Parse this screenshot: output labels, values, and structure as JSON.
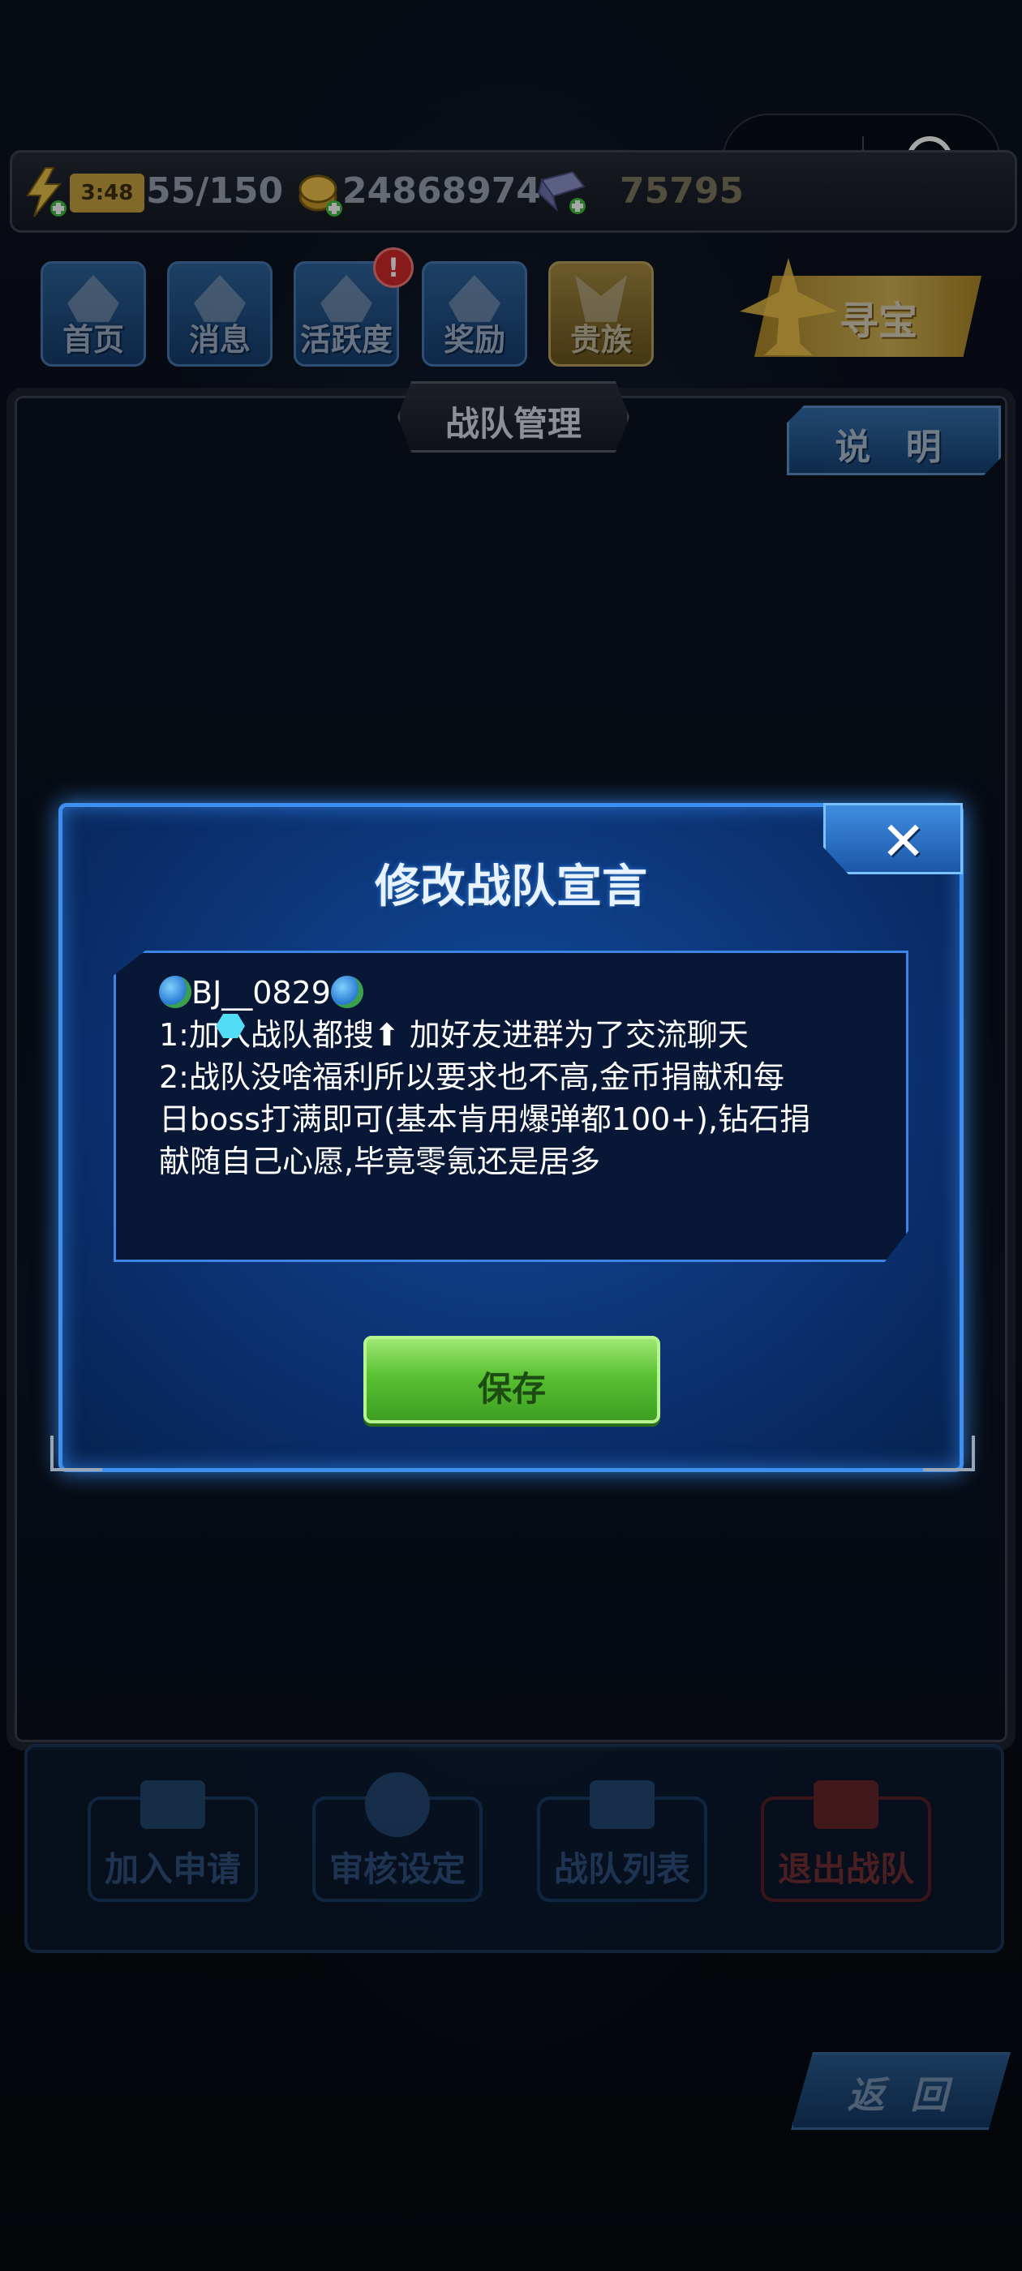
{
  "status_bar": {
    "timer": "3:48",
    "energy": "55/150",
    "gold": "24868974",
    "diamond": "75795"
  },
  "nav": [
    {
      "label": "首页",
      "icon": "home-plane-icon"
    },
    {
      "label": "消息",
      "icon": "envelope-icon"
    },
    {
      "label": "活跃度",
      "icon": "smile-wings-icon",
      "badge": "!"
    },
    {
      "label": "奖励",
      "icon": "gift-icon"
    },
    {
      "label": "贵族",
      "icon": "noble-emblem-icon"
    }
  ],
  "treasure_label": "寻宝",
  "page_title": "战队管理",
  "help_label": "说 明",
  "actions": [
    {
      "label": "加入申请",
      "icon": "envelope-icon"
    },
    {
      "label": "审核设定",
      "icon": "check-circle-icon"
    },
    {
      "label": "战队列表",
      "icon": "list-icon"
    },
    {
      "label": "退出战队",
      "icon": "exit-icon"
    }
  ],
  "back_label": "返 回",
  "dialog": {
    "title": "修改战队宣言",
    "close_symbol": "✕",
    "declaration_lines": [
      "BJ__0829",
      "1:加入战队都搜⬆  加好友进群为了交流聊天",
      "2:战队没啥福利所以要求也不高,金币捐献和每",
      "日boss打满即可(基本肯用爆弹都100+),钻石捐",
      "献随自己心愿,毕竟零氪还是居多"
    ],
    "save_label": "保存"
  },
  "colors": {
    "dialog_border": "#3d8ff0",
    "save_green": "#59c133",
    "gold": "#f1c44a",
    "badge_red": "#d02a2a"
  }
}
